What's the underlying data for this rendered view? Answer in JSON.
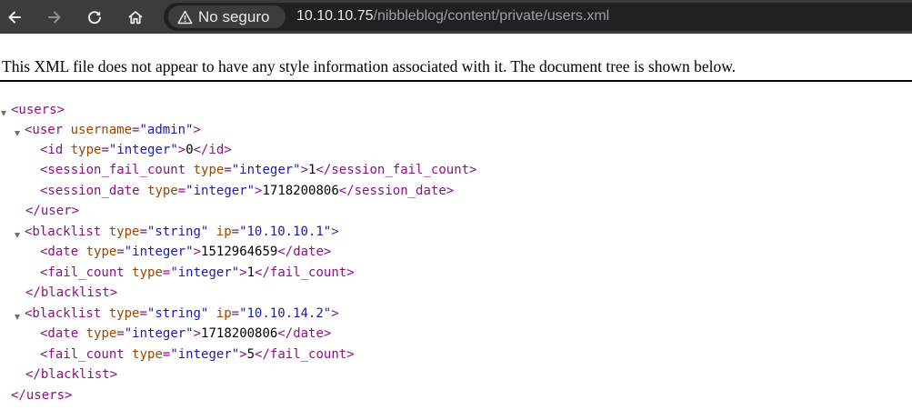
{
  "browser": {
    "security_label": "No seguro",
    "url_host": "10.10.10.75",
    "url_path": "/nibbleblog/content/private/users.xml",
    "icons": {
      "back": "arrow-left-icon",
      "forward": "arrow-right-icon",
      "reload": "reload-icon",
      "home": "home-icon",
      "security": "warning-triangle-icon"
    }
  },
  "xml_viewer": {
    "notice": "This XML file does not appear to have any style information associated with it. The document tree is shown below.",
    "tree": {
      "users_open": "<users>",
      "user_open_start": "<user",
      "user_attr_name": "username",
      "user_attr_value": "\"admin\"",
      "id_open_start": "<id",
      "id_attr_name": "type",
      "id_attr_value": "\"integer\"",
      "id_value": "0",
      "id_close": "</id>",
      "sfc_open_start": "<session_fail_count",
      "sfc_attr_name": "type",
      "sfc_attr_value": "\"integer\"",
      "sfc_value": "1",
      "sfc_close": "</session_fail_count>",
      "sd_open_start": "<session_date",
      "sd_attr_name": "type",
      "sd_attr_value": "\"integer\"",
      "sd_value": "1718200806",
      "sd_close": "</session_date>",
      "user_close": "</user>",
      "bl1_open_start": "<blacklist",
      "bl1_type_name": "type",
      "bl1_type_value": "\"string\"",
      "bl1_ip_name": "ip",
      "bl1_ip_value": "\"10.10.10.1\"",
      "bl1_date_open_start": "<date",
      "bl1_date_attr_name": "type",
      "bl1_date_attr_value": "\"integer\"",
      "bl1_date_value": "1512964659",
      "bl1_date_close": "</date>",
      "bl1_fc_open_start": "<fail_count",
      "bl1_fc_attr_name": "type",
      "bl1_fc_attr_value": "\"integer\"",
      "bl1_fc_value": "1",
      "bl1_fc_close": "</fail_count>",
      "bl1_close": "</blacklist>",
      "bl2_open_start": "<blacklist",
      "bl2_type_name": "type",
      "bl2_type_value": "\"string\"",
      "bl2_ip_name": "ip",
      "bl2_ip_value": "\"10.10.14.2\"",
      "bl2_date_open_start": "<date",
      "bl2_date_attr_name": "type",
      "bl2_date_attr_value": "\"integer\"",
      "bl2_date_value": "1718200806",
      "bl2_date_close": "</date>",
      "bl2_fc_open_start": "<fail_count",
      "bl2_fc_attr_name": "type",
      "bl2_fc_attr_value": "\"integer\"",
      "bl2_fc_value": "5",
      "bl2_fc_close": "</fail_count>",
      "bl2_close": "</blacklist>",
      "users_close": "</users>"
    }
  }
}
